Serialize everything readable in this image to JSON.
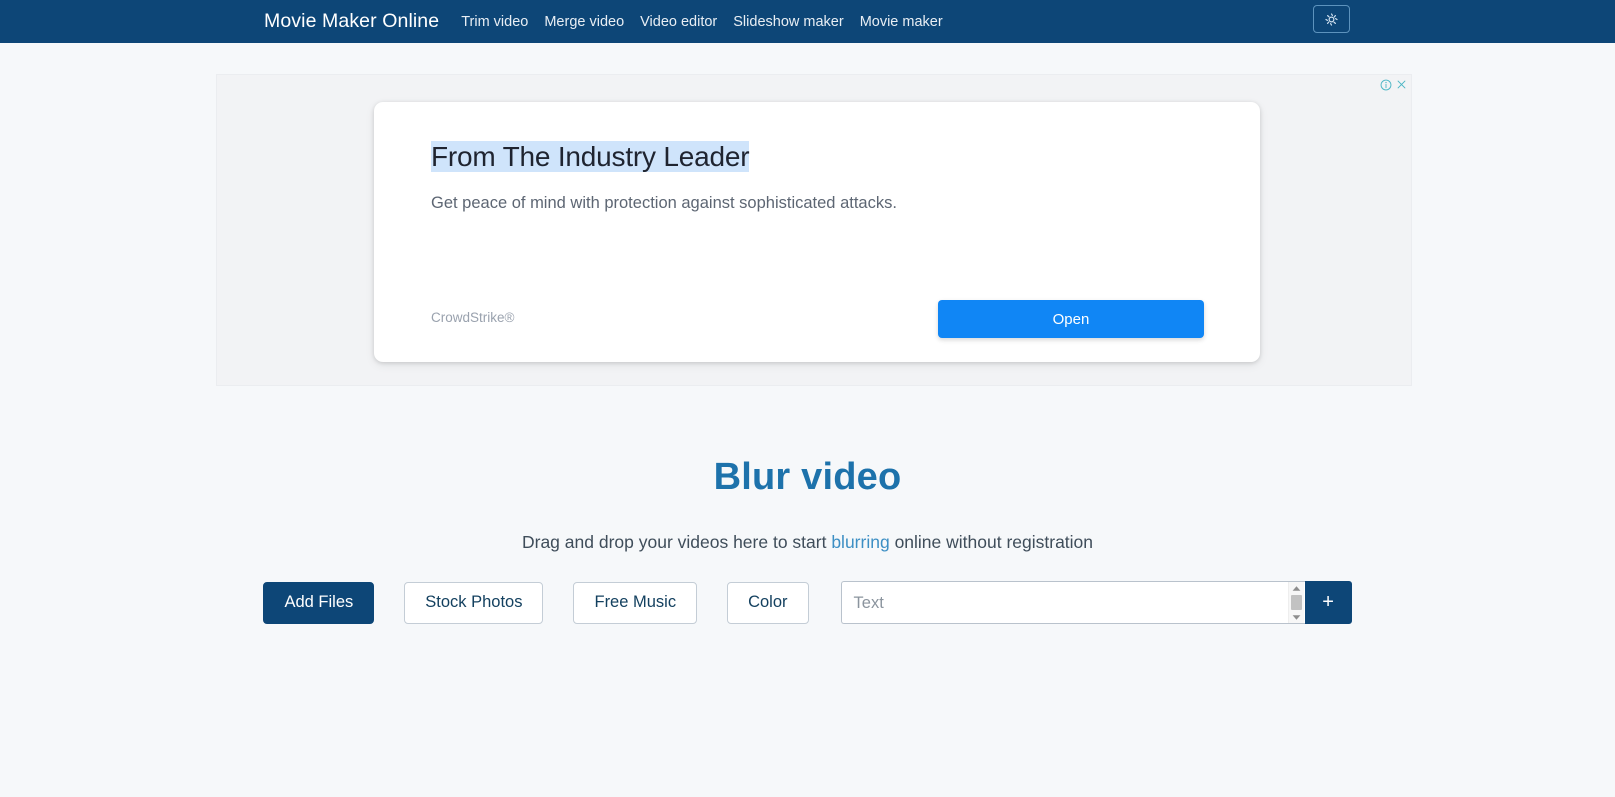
{
  "navbar": {
    "brand": "Movie Maker Online",
    "links": [
      {
        "label": "Trim video"
      },
      {
        "label": "Merge video"
      },
      {
        "label": "Video editor"
      },
      {
        "label": "Slideshow maker"
      },
      {
        "label": "Movie maker"
      }
    ],
    "settings_icon": "gear-icon",
    "background_color": "#0d4677",
    "text_color": "#ffffff"
  },
  "ad": {
    "info_icon": "info-icon",
    "close_icon": "close-icon",
    "controls_color": "#4ab5c4",
    "headline": "From The Industry Leader",
    "subtext": "Get peace of mind with protection against sophisticated attacks.",
    "advertiser": "CrowdStrike®",
    "cta_label": "Open",
    "cta_color": "#1086f5",
    "highlight_color": "#cfe4fb"
  },
  "hero": {
    "title": "Blur video",
    "title_color": "#1d72ab",
    "subtitle_before": "Drag and drop your videos here to start ",
    "subtitle_link": "blurring",
    "subtitle_after": " online without registration"
  },
  "actions": {
    "add_files": "Add Files",
    "stock_photos": "Stock Photos",
    "free_music": "Free Music",
    "color": "Color",
    "text_placeholder": "Text",
    "text_value": "",
    "add_text_label": "+",
    "primary_color": "#0d4677"
  }
}
